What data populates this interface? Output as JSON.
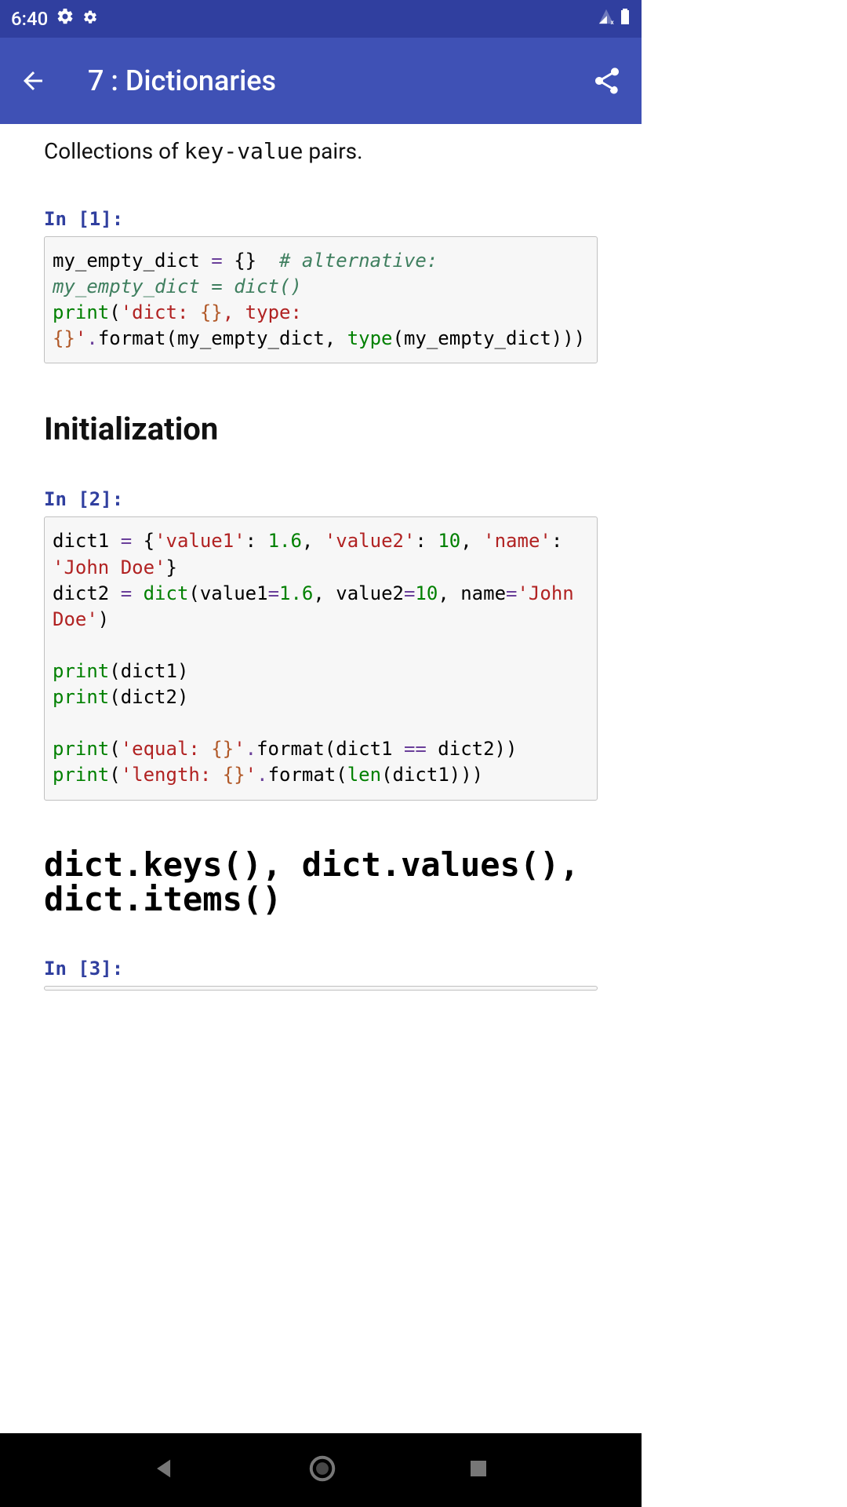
{
  "status": {
    "time": "6:40",
    "icons": [
      "gear-icon",
      "gear-small-icon",
      "signal-icon",
      "battery-icon"
    ]
  },
  "appbar": {
    "title": "7 : Dictionaries"
  },
  "intro": {
    "pre": "Collections of ",
    "code": "key-value",
    "post": " pairs."
  },
  "cells": [
    {
      "prompt": "In [1]:",
      "code_html": "my_empty_dict <span class='op'>=</span> {}  <span class='c1'># alternative: my_empty_dict = dict()</span>\n<span class='nb'>print</span>(<span class='str'>'dict: </span><span class='si'>{}</span><span class='str'>, type: </span><span class='si'>{}</span><span class='str'>'</span><span class='op'>.</span>format(my_empty_dict, <span class='nb'>type</span>(my_empty_dict)))"
    },
    {
      "heading": "Initialization",
      "heading_type": "plain"
    },
    {
      "prompt": "In [2]:",
      "code_html": "dict1 <span class='op'>=</span> {<span class='str'>'value1'</span>: <span class='mi'>1.6</span>, <span class='str'>'value2'</span>: <span class='mi'>10</span>, <span class='str'>'name'</span>: <span class='str'>'John Doe'</span>}\ndict2 <span class='op'>=</span> <span class='nb'>dict</span>(value1<span class='op'>=</span><span class='mi'>1.6</span>, value2<span class='op'>=</span><span class='mi'>10</span>, name<span class='op'>=</span><span class='str'>'John Doe'</span>)\n\n<span class='nb'>print</span>(dict1)\n<span class='nb'>print</span>(dict2)\n\n<span class='nb'>print</span>(<span class='str'>'equal: </span><span class='si'>{}</span><span class='str'>'</span><span class='op'>.</span>format(dict1 <span class='op'>==</span> dict2))\n<span class='nb'>print</span>(<span class='str'>'length: </span><span class='si'>{}</span><span class='str'>'</span><span class='op'>.</span>format(<span class='nb'>len</span>(dict1)))"
    },
    {
      "heading": "dict.keys(), dict.values(), dict.items()",
      "heading_type": "mono"
    },
    {
      "prompt": "In [3]:",
      "code_html": ""
    }
  ]
}
